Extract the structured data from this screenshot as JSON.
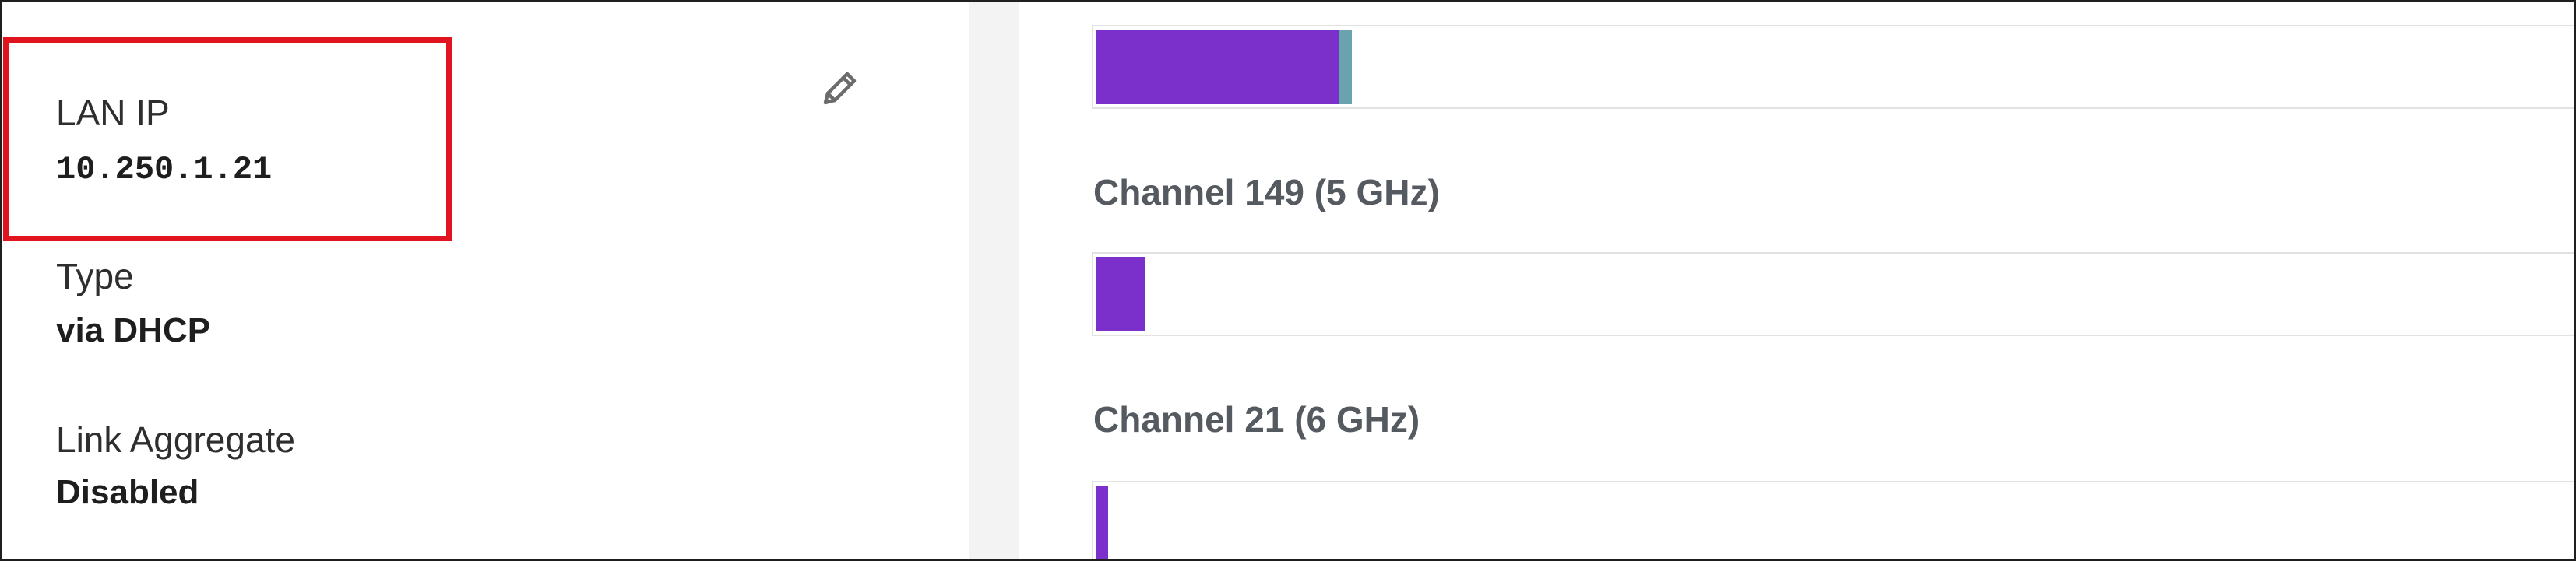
{
  "details": {
    "lan_ip": {
      "label": "LAN IP",
      "value": "10.250.1.21"
    },
    "type": {
      "label": "Type",
      "value": "via DHCP"
    },
    "link_aggregate": {
      "label": "Link Aggregate",
      "value": "Disabled"
    },
    "edit_icon": "pencil-icon"
  },
  "channels": [
    {
      "title": "",
      "fill_percent": 16.4,
      "secondary_percent": 0.85,
      "colors": {
        "primary": "#7b2fcb",
        "secondary": "#6aa3ad"
      }
    },
    {
      "title": "Channel 149 (5 GHz)",
      "fill_percent": 3.3,
      "colors": {
        "primary": "#7b2fcb"
      }
    },
    {
      "title": "Channel 21 (6 GHz)",
      "fill_percent": 0.8,
      "colors": {
        "primary": "#7b2fcb"
      }
    }
  ],
  "highlight_color": "#e0141e"
}
